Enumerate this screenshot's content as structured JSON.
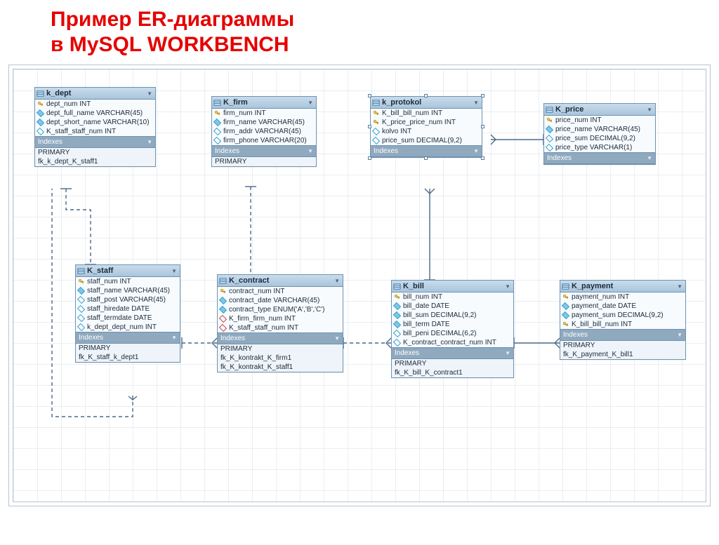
{
  "heading_line1": "Пример ER-диаграммы",
  "heading_line2": "в MySQL WORKBENCH",
  "section_label": "Indexes",
  "tables": {
    "k_dept": {
      "title": "k_dept",
      "cols": [
        {
          "icon": "key",
          "name": "dept_num INT"
        },
        {
          "icon": "diamond-filled",
          "name": "dept_full_name VARCHAR(45)"
        },
        {
          "icon": "diamond-filled",
          "name": "dept_short_name VARCHAR(10)"
        },
        {
          "icon": "diamond",
          "name": "K_staff_staff_num INT"
        }
      ],
      "idx": [
        "PRIMARY",
        "fk_k_dept_K_staff1"
      ]
    },
    "k_firm": {
      "title": "K_firm",
      "cols": [
        {
          "icon": "key",
          "name": "firm_num INT"
        },
        {
          "icon": "diamond-filled",
          "name": "firm_name VARCHAR(45)"
        },
        {
          "icon": "diamond",
          "name": "firm_addr VARCHAR(45)"
        },
        {
          "icon": "diamond",
          "name": "firm_phone VARCHAR(20)"
        }
      ],
      "idx": [
        "PRIMARY"
      ]
    },
    "k_protokol": {
      "title": "k_protokol",
      "cols": [
        {
          "icon": "key",
          "name": "K_bill_bill_num INT"
        },
        {
          "icon": "key",
          "name": "K_price_price_num INT"
        },
        {
          "icon": "diamond",
          "name": "kolvo INT"
        },
        {
          "icon": "diamond",
          "name": "price_sum DECIMAL(9,2)"
        }
      ],
      "idx": []
    },
    "k_price": {
      "title": "K_price",
      "cols": [
        {
          "icon": "key",
          "name": "price_num INT"
        },
        {
          "icon": "diamond-filled",
          "name": "price_name VARCHAR(45)"
        },
        {
          "icon": "diamond",
          "name": "price_sum DECIMAL(9,2)"
        },
        {
          "icon": "diamond",
          "name": "price_type VARCHAR(1)"
        }
      ],
      "idx": []
    },
    "k_staff": {
      "title": "K_staff",
      "cols": [
        {
          "icon": "key",
          "name": "staff_num INT"
        },
        {
          "icon": "diamond-filled",
          "name": "staff_name VARCHAR(45)"
        },
        {
          "icon": "diamond",
          "name": "staff_post VARCHAR(45)"
        },
        {
          "icon": "diamond",
          "name": "staff_hiredate DATE"
        },
        {
          "icon": "diamond",
          "name": "staff_termdate DATE"
        },
        {
          "icon": "diamond",
          "name": "k_dept_dept_num INT"
        }
      ],
      "idx": [
        "PRIMARY",
        "fk_K_staff_k_dept1"
      ]
    },
    "k_contract": {
      "title": "K_contract",
      "cols": [
        {
          "icon": "key",
          "name": "contract_num INT"
        },
        {
          "icon": "diamond-filled",
          "name": "contract_date VARCHAR(45)"
        },
        {
          "icon": "diamond-filled",
          "name": "contract_type ENUM('A','B','C')"
        },
        {
          "icon": "diamond-red",
          "name": "K_firm_firm_num INT"
        },
        {
          "icon": "diamond-red",
          "name": "K_staff_staff_num INT"
        }
      ],
      "idx": [
        "PRIMARY",
        "fk_K_kontrakt_K_firm1",
        "fk_K_kontrakt_K_staff1"
      ]
    },
    "k_bill": {
      "title": "K_bill",
      "cols": [
        {
          "icon": "key",
          "name": "bill_num INT"
        },
        {
          "icon": "diamond-filled",
          "name": "bill_date DATE"
        },
        {
          "icon": "diamond-filled",
          "name": "bill_sum DECIMAL(9,2)"
        },
        {
          "icon": "diamond-filled",
          "name": "bill_term DATE"
        },
        {
          "icon": "diamond",
          "name": "bill_peni DECIMAL(6,2)"
        },
        {
          "icon": "diamond",
          "name": "K_contract_contract_num INT"
        }
      ],
      "idx": [
        "PRIMARY",
        "fk_K_bill_K_contract1"
      ]
    },
    "k_payment": {
      "title": "K_payment",
      "cols": [
        {
          "icon": "key",
          "name": "payment_num INT"
        },
        {
          "icon": "diamond-filled",
          "name": "payment_date DATE"
        },
        {
          "icon": "diamond-filled",
          "name": "payment_sum DECIMAL(9,2)"
        },
        {
          "icon": "key",
          "name": "K_bill_bill_num INT"
        }
      ],
      "idx": [
        "PRIMARY",
        "fk_K_payment_K_bill1"
      ]
    }
  }
}
